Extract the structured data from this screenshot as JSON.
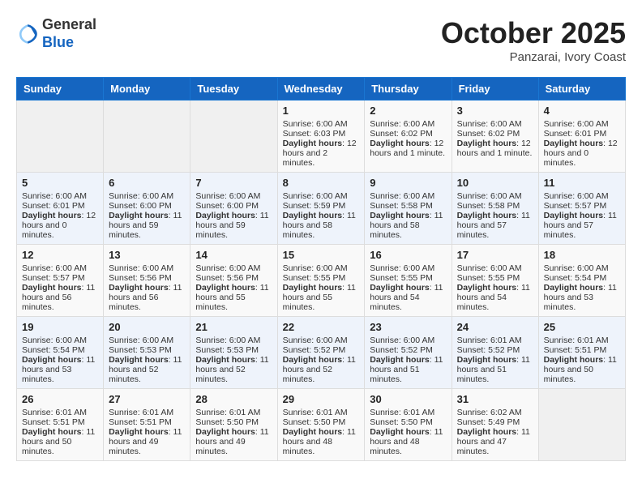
{
  "logo": {
    "general": "General",
    "blue": "Blue"
  },
  "header": {
    "month": "October 2025",
    "location": "Panzarai, Ivory Coast"
  },
  "weekdays": [
    "Sunday",
    "Monday",
    "Tuesday",
    "Wednesday",
    "Thursday",
    "Friday",
    "Saturday"
  ],
  "weeks": [
    [
      {
        "day": "",
        "info": ""
      },
      {
        "day": "",
        "info": ""
      },
      {
        "day": "",
        "info": ""
      },
      {
        "day": "1",
        "info": "Sunrise: 6:00 AM\nSunset: 6:03 PM\nDaylight: 12 hours and 2 minutes."
      },
      {
        "day": "2",
        "info": "Sunrise: 6:00 AM\nSunset: 6:02 PM\nDaylight: 12 hours and 1 minute."
      },
      {
        "day": "3",
        "info": "Sunrise: 6:00 AM\nSunset: 6:02 PM\nDaylight: 12 hours and 1 minute."
      },
      {
        "day": "4",
        "info": "Sunrise: 6:00 AM\nSunset: 6:01 PM\nDaylight: 12 hours and 0 minutes."
      }
    ],
    [
      {
        "day": "5",
        "info": "Sunrise: 6:00 AM\nSunset: 6:01 PM\nDaylight: 12 hours and 0 minutes."
      },
      {
        "day": "6",
        "info": "Sunrise: 6:00 AM\nSunset: 6:00 PM\nDaylight: 11 hours and 59 minutes."
      },
      {
        "day": "7",
        "info": "Sunrise: 6:00 AM\nSunset: 6:00 PM\nDaylight: 11 hours and 59 minutes."
      },
      {
        "day": "8",
        "info": "Sunrise: 6:00 AM\nSunset: 5:59 PM\nDaylight: 11 hours and 58 minutes."
      },
      {
        "day": "9",
        "info": "Sunrise: 6:00 AM\nSunset: 5:58 PM\nDaylight: 11 hours and 58 minutes."
      },
      {
        "day": "10",
        "info": "Sunrise: 6:00 AM\nSunset: 5:58 PM\nDaylight: 11 hours and 57 minutes."
      },
      {
        "day": "11",
        "info": "Sunrise: 6:00 AM\nSunset: 5:57 PM\nDaylight: 11 hours and 57 minutes."
      }
    ],
    [
      {
        "day": "12",
        "info": "Sunrise: 6:00 AM\nSunset: 5:57 PM\nDaylight: 11 hours and 56 minutes."
      },
      {
        "day": "13",
        "info": "Sunrise: 6:00 AM\nSunset: 5:56 PM\nDaylight: 11 hours and 56 minutes."
      },
      {
        "day": "14",
        "info": "Sunrise: 6:00 AM\nSunset: 5:56 PM\nDaylight: 11 hours and 55 minutes."
      },
      {
        "day": "15",
        "info": "Sunrise: 6:00 AM\nSunset: 5:55 PM\nDaylight: 11 hours and 55 minutes."
      },
      {
        "day": "16",
        "info": "Sunrise: 6:00 AM\nSunset: 5:55 PM\nDaylight: 11 hours and 54 minutes."
      },
      {
        "day": "17",
        "info": "Sunrise: 6:00 AM\nSunset: 5:55 PM\nDaylight: 11 hours and 54 minutes."
      },
      {
        "day": "18",
        "info": "Sunrise: 6:00 AM\nSunset: 5:54 PM\nDaylight: 11 hours and 53 minutes."
      }
    ],
    [
      {
        "day": "19",
        "info": "Sunrise: 6:00 AM\nSunset: 5:54 PM\nDaylight: 11 hours and 53 minutes."
      },
      {
        "day": "20",
        "info": "Sunrise: 6:00 AM\nSunset: 5:53 PM\nDaylight: 11 hours and 52 minutes."
      },
      {
        "day": "21",
        "info": "Sunrise: 6:00 AM\nSunset: 5:53 PM\nDaylight: 11 hours and 52 minutes."
      },
      {
        "day": "22",
        "info": "Sunrise: 6:00 AM\nSunset: 5:52 PM\nDaylight: 11 hours and 52 minutes."
      },
      {
        "day": "23",
        "info": "Sunrise: 6:00 AM\nSunset: 5:52 PM\nDaylight: 11 hours and 51 minutes."
      },
      {
        "day": "24",
        "info": "Sunrise: 6:01 AM\nSunset: 5:52 PM\nDaylight: 11 hours and 51 minutes."
      },
      {
        "day": "25",
        "info": "Sunrise: 6:01 AM\nSunset: 5:51 PM\nDaylight: 11 hours and 50 minutes."
      }
    ],
    [
      {
        "day": "26",
        "info": "Sunrise: 6:01 AM\nSunset: 5:51 PM\nDaylight: 11 hours and 50 minutes."
      },
      {
        "day": "27",
        "info": "Sunrise: 6:01 AM\nSunset: 5:51 PM\nDaylight: 11 hours and 49 minutes."
      },
      {
        "day": "28",
        "info": "Sunrise: 6:01 AM\nSunset: 5:50 PM\nDaylight: 11 hours and 49 minutes."
      },
      {
        "day": "29",
        "info": "Sunrise: 6:01 AM\nSunset: 5:50 PM\nDaylight: 11 hours and 48 minutes."
      },
      {
        "day": "30",
        "info": "Sunrise: 6:01 AM\nSunset: 5:50 PM\nDaylight: 11 hours and 48 minutes."
      },
      {
        "day": "31",
        "info": "Sunrise: 6:02 AM\nSunset: 5:49 PM\nDaylight: 11 hours and 47 minutes."
      },
      {
        "day": "",
        "info": ""
      }
    ]
  ]
}
